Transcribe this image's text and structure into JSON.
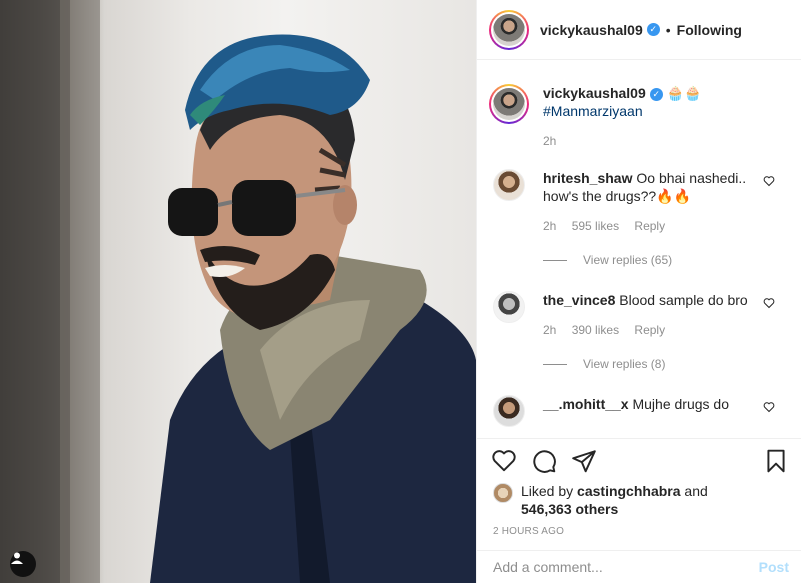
{
  "header": {
    "username": "vickykaushal09",
    "separator": "•",
    "follow_status": "Following"
  },
  "caption": {
    "username": "vickykaushal09",
    "emoji": "🧁🧁",
    "hashtag": "#Manmarziyaan",
    "time": "2h"
  },
  "comments": [
    {
      "username": "hritesh_shaw",
      "text": "Oo bhai nashedi.. how's the drugs??🔥🔥",
      "time": "2h",
      "likes": "595 likes",
      "reply": "Reply",
      "view_replies": "View replies (65)"
    },
    {
      "username": "the_vince8",
      "text": "Blood sample do bro",
      "time": "2h",
      "likes": "390 likes",
      "reply": "Reply",
      "view_replies": "View replies (8)"
    },
    {
      "username": "__.mohitt__x",
      "text": "Mujhe drugs do"
    }
  ],
  "likes": {
    "prefix": "Liked by",
    "user": "castingchhabra",
    "and": "and",
    "count": "546,363 others"
  },
  "timestamp": "2 HOURS AGO",
  "add_comment": {
    "placeholder": "Add a comment...",
    "post_label": "Post"
  },
  "icons": {
    "like": "heart-icon",
    "comment": "comment-icon",
    "share": "paper-plane-icon",
    "save": "bookmark-icon",
    "tag": "user-tag-icon"
  },
  "colors": {
    "verified": "#3897f0",
    "hashtag": "#00376b",
    "post_disabled": "#b2dffc",
    "muted": "#8e8e8e"
  }
}
